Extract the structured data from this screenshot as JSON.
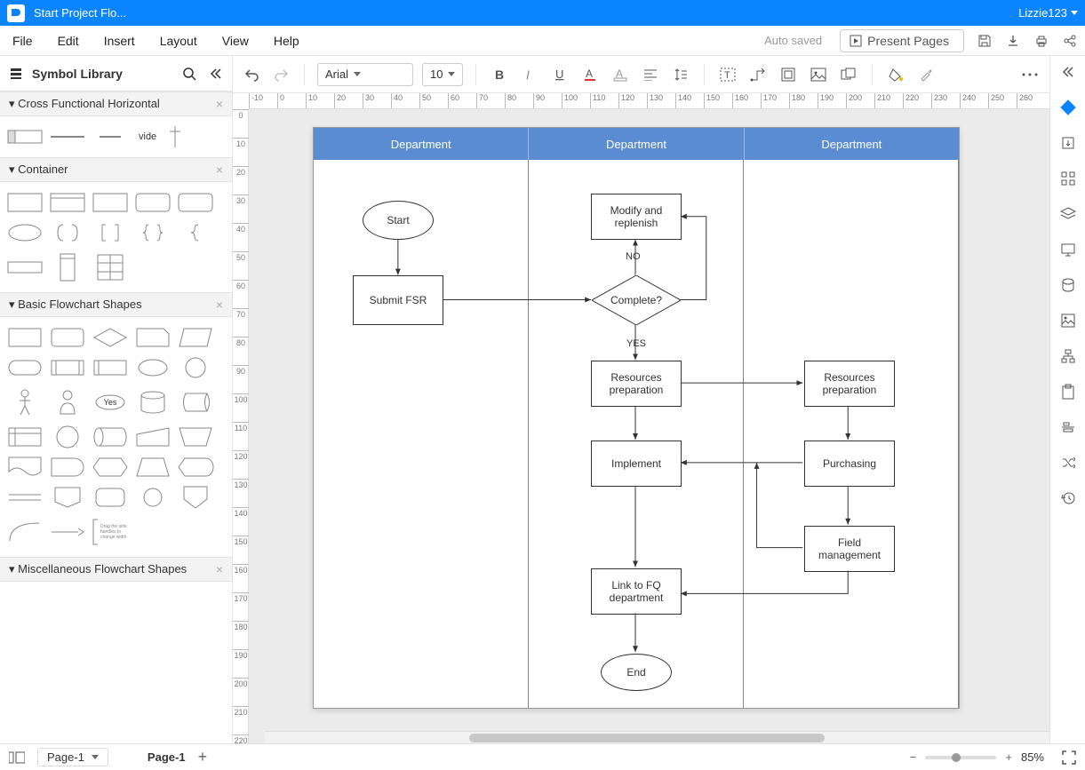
{
  "titlebar": {
    "doc_title": "Start Project Flo...",
    "user": "Lizzie123"
  },
  "menu": {
    "file": "File",
    "edit": "Edit",
    "insert": "Insert",
    "layout": "Layout",
    "view": "View",
    "help": "Help",
    "autosaved": "Auto saved",
    "present": "Present Pages"
  },
  "sidebar": {
    "title": "Symbol Library",
    "sections": {
      "cross": "Cross Functional Horizontal",
      "container": "Container",
      "basic": "Basic Flowchart Shapes",
      "misc": "Miscellaneous Flowchart Shapes"
    },
    "vide_label": "vide",
    "yes_shape": "Yes"
  },
  "toolbar": {
    "font": "Arial",
    "size": "10"
  },
  "ruler_h": [
    -10,
    0,
    10,
    20,
    30,
    40,
    50,
    60,
    70,
    80,
    90,
    100,
    110,
    120,
    130,
    140,
    150,
    160,
    170,
    180,
    190,
    200,
    210,
    220,
    230,
    240,
    250,
    260
  ],
  "ruler_v": [
    0,
    10,
    20,
    30,
    40,
    50,
    60,
    70,
    80,
    90,
    100,
    110,
    120,
    130,
    140,
    150,
    160,
    170,
    180,
    190,
    200,
    210,
    220
  ],
  "lanes": [
    "Department",
    "Department",
    "Department"
  ],
  "flow": {
    "start": "Start",
    "submit": "Submit FSR",
    "modify": "Modify and replenish",
    "complete": "Complete?",
    "no": "NO",
    "yes": "YES",
    "res1": "Resources preparation",
    "res2": "Resources preparation",
    "implement": "Implement",
    "purchasing": "Purchasing",
    "field": "Field management",
    "link": "Link to FQ department",
    "end": "End"
  },
  "footer": {
    "page_sel": "Page-1",
    "page_tab": "Page-1",
    "zoom": "85%"
  }
}
